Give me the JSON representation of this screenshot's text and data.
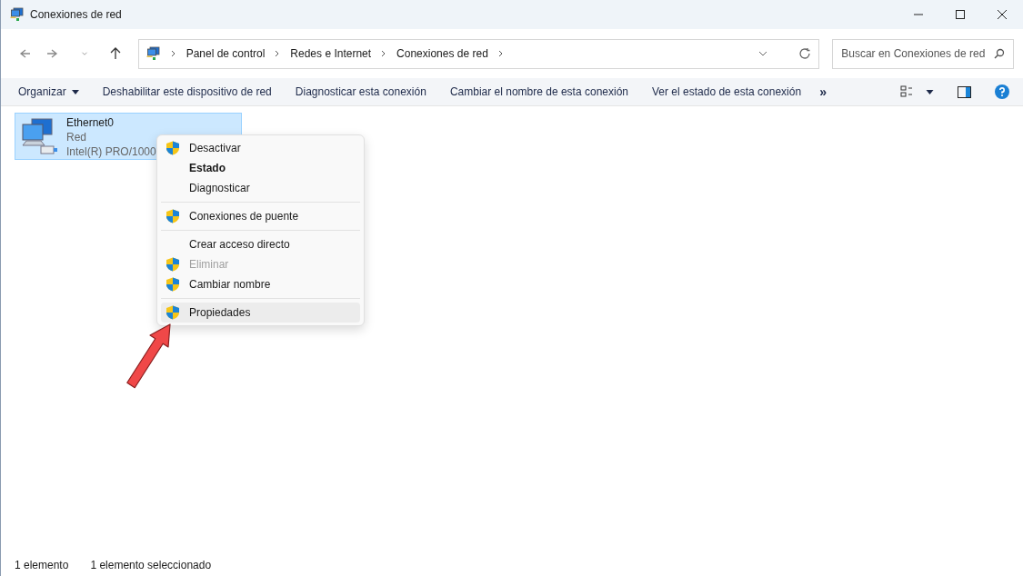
{
  "window": {
    "title": "Conexiones de red"
  },
  "breadcrumb": [
    "Panel de control",
    "Redes e Internet",
    "Conexiones de red"
  ],
  "search": {
    "placeholder": "Buscar en Conexiones de red"
  },
  "commands": [
    {
      "label": "Organizar",
      "kind": "dropdown"
    },
    {
      "label": "Deshabilitar este dispositivo de red",
      "kind": "plain"
    },
    {
      "label": "Diagnosticar esta conexión",
      "kind": "plain"
    },
    {
      "label": "Cambiar el nombre de esta conexión",
      "kind": "plain"
    },
    {
      "label": "Ver el estado de esta conexión",
      "kind": "plain"
    },
    {
      "label": "»",
      "kind": "more"
    }
  ],
  "items": [
    {
      "name": "Ethernet0",
      "status": "Red",
      "device": "Intel(R) PRO/1000",
      "selected": true
    }
  ],
  "context_menu": [
    {
      "kind": "item",
      "label": "Desactivar",
      "shield": true,
      "bold": false,
      "disabled": false,
      "selected": false
    },
    {
      "kind": "item",
      "label": "Estado",
      "shield": false,
      "bold": true,
      "disabled": false,
      "selected": false
    },
    {
      "kind": "item",
      "label": "Diagnosticar",
      "shield": false,
      "bold": false,
      "disabled": false,
      "selected": false
    },
    {
      "kind": "separator"
    },
    {
      "kind": "item",
      "label": "Conexiones de puente",
      "shield": true,
      "bold": false,
      "disabled": false,
      "selected": false
    },
    {
      "kind": "separator"
    },
    {
      "kind": "item",
      "label": "Crear acceso directo",
      "shield": false,
      "bold": false,
      "disabled": false,
      "selected": false
    },
    {
      "kind": "item",
      "label": "Eliminar",
      "shield": true,
      "bold": false,
      "disabled": true,
      "selected": false
    },
    {
      "kind": "item",
      "label": "Cambiar nombre",
      "shield": true,
      "bold": false,
      "disabled": false,
      "selected": false
    },
    {
      "kind": "separator"
    },
    {
      "kind": "item",
      "label": "Propiedades",
      "shield": true,
      "bold": false,
      "disabled": false,
      "selected": true
    }
  ],
  "status_bar": [
    "1 elemento",
    "1 elemento seleccionado"
  ]
}
